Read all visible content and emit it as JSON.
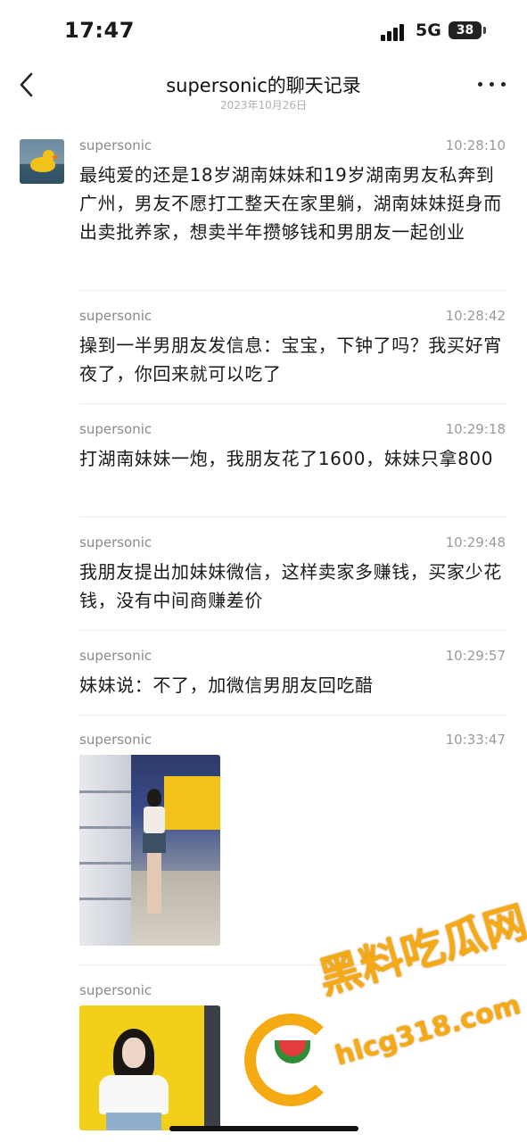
{
  "status_bar": {
    "time": "17:47",
    "network": "5G",
    "battery": "38"
  },
  "nav": {
    "title": "supersonic的聊天记录",
    "subtitle": "2023年10月26日"
  },
  "messages": [
    {
      "sender": "supersonic",
      "time": "10:28:10",
      "text": "最纯爱的还是18岁湖南妹妹和19岁湖南男友私奔到广州，男友不愿打工整天在家里躺，湖南妹妹挺身而出卖批养家，想卖半年攒够钱和男朋友一起创业"
    },
    {
      "sender": "supersonic",
      "time": "10:28:42",
      "text": "操到一半男朋友发信息：宝宝，下钟了吗？我买好宵夜了，你回来就可以吃了"
    },
    {
      "sender": "supersonic",
      "time": "10:29:18",
      "text": "打湖南妹妹一炮，我朋友花了1600，妹妹只拿800"
    },
    {
      "sender": "supersonic",
      "time": "10:29:48",
      "text": "我朋友提出加妹妹微信，这样卖家多赚钱，买家少花钱，没有中间商赚差价"
    },
    {
      "sender": "supersonic",
      "time": "10:29:57",
      "text": "妹妹说：不了，加微信男朋友回吃醋"
    },
    {
      "sender": "supersonic",
      "time": "10:33:47",
      "image": "photo-in-store"
    },
    {
      "sender": "supersonic",
      "time": "",
      "image": "photo-yellow-wall"
    }
  ],
  "watermark": {
    "title": "黑料吃瓜网",
    "url": "hlcg318.com"
  },
  "icons": {
    "back": "chevron-left-icon",
    "more": "more-dots-icon",
    "avatar": "duck-avatar"
  }
}
